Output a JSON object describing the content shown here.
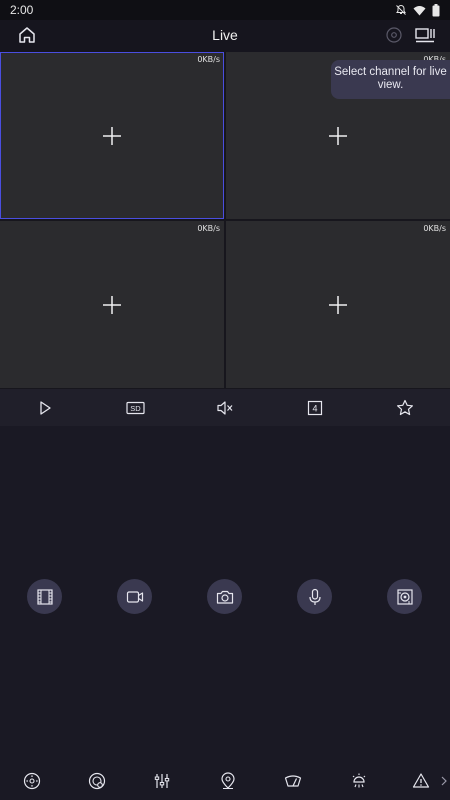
{
  "status_bar": {
    "time": "2:00",
    "icons": [
      "notifications-off-icon",
      "wifi-icon",
      "battery-icon"
    ]
  },
  "app_bar": {
    "title": "Live",
    "left_icon": "home-icon",
    "right_icons": [
      "record-icon",
      "window-switch-icon"
    ]
  },
  "channels": [
    {
      "rate": "0KB/s",
      "selected": true
    },
    {
      "rate": "0KB/s",
      "selected": false
    },
    {
      "rate": "0KB/s",
      "selected": false
    },
    {
      "rate": "0KB/s",
      "selected": false
    }
  ],
  "tooltip": {
    "text": "Select channel for live view."
  },
  "toolbar": {
    "items": [
      "play-icon",
      "sd-icon",
      "mute-icon",
      "split-4-icon",
      "favorite-icon"
    ],
    "sd_label": "SD",
    "split_label": "4"
  },
  "actions": {
    "items": [
      "playback-icon",
      "record-video-icon",
      "snapshot-icon",
      "talk-icon",
      "fisheye-icon"
    ]
  },
  "bottom_bar": {
    "items": [
      "ptz-icon",
      "color-icon",
      "image-adjust-icon",
      "location-icon",
      "wiper-icon",
      "light-icon",
      "alarm-icon",
      "more-icon"
    ]
  },
  "colors": {
    "background": "#1a1924",
    "cell": "#2b2b2e",
    "selected_border": "#4a4ee0",
    "tooltip_bg": "#3a3950",
    "action_circle": "#3a3950",
    "icon": "#e6e6ee"
  }
}
